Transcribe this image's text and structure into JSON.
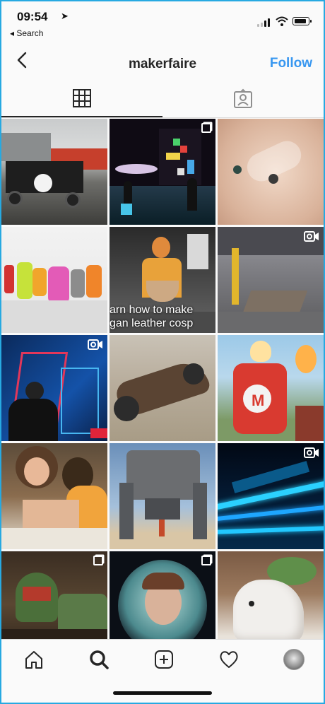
{
  "status_bar": {
    "time": "09:54",
    "back_app_label": "◂ Search"
  },
  "header": {
    "title": "makerfaire",
    "follow_label": "Follow"
  },
  "tabs": [
    {
      "icon": "grid-icon",
      "active": true
    },
    {
      "icon": "tagged-icon",
      "active": false
    }
  ],
  "posts": [
    {
      "scene": "trucks-outdoors",
      "badge": "none",
      "caption": ""
    },
    {
      "scene": "tetris-led-crowd",
      "badge": "multi",
      "caption": ""
    },
    {
      "scene": "robot-hand-closeup",
      "badge": "none",
      "caption": ""
    },
    {
      "scene": "colorful-3d-printed-figures",
      "badge": "none",
      "caption": ""
    },
    {
      "scene": "maker-tutorial-video",
      "badge": "none",
      "caption": "arn how to make\ngan leather cosp"
    },
    {
      "scene": "workshop-floor",
      "badge": "video",
      "caption": ""
    },
    {
      "scene": "vr-game-player",
      "badge": "video",
      "caption": ""
    },
    {
      "scene": "wooden-vehicle",
      "badge": "none",
      "caption": ""
    },
    {
      "scene": "giant-fire-robot",
      "badge": "none",
      "caption": ""
    },
    {
      "scene": "kids-crafting",
      "badge": "none",
      "caption": ""
    },
    {
      "scene": "mech-sculpture",
      "badge": "none",
      "caption": ""
    },
    {
      "scene": "neon-structure-night",
      "badge": "video",
      "caption": ""
    },
    {
      "scene": "armored-figure",
      "badge": "multi",
      "caption": ""
    },
    {
      "scene": "astronaut-helmet-portrait",
      "badge": "multi",
      "caption": ""
    },
    {
      "scene": "white-sculpture-plant",
      "badge": "none",
      "caption": ""
    }
  ],
  "bottom_nav": [
    "home-icon",
    "search-icon",
    "add-icon",
    "heart-icon",
    "profile-avatar"
  ],
  "colors": {
    "accent": "#3897f0",
    "frame": "#27a9e1",
    "text": "#262626"
  }
}
